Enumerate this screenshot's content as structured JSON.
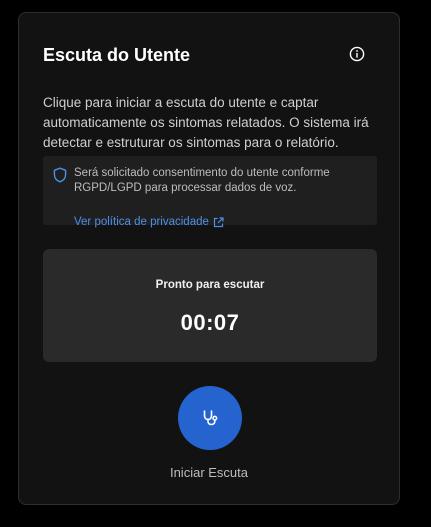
{
  "panel": {
    "title": "Escuta do Utente",
    "info_icon": "info-circle-icon",
    "description": "Clique para iniciar a escuta do utente e captar automaticamente os sintomas relatados. O sistema irá detectar e estruturar os sintomas para o relatório."
  },
  "consent": {
    "icon": "shield-icon",
    "text": "Será solicitado consentimento do utente conforme RGPD/LGPD para processar dados de voz.",
    "link_label": "Ver política de privacidade",
    "link_icon": "external-link-icon"
  },
  "timer": {
    "status": "Pronto para escutar",
    "value": "00:07"
  },
  "action": {
    "icon": "stethoscope-icon",
    "label": "Iniciar Escuta"
  },
  "colors": {
    "background": "#000000",
    "card": "#121212",
    "panel": "#2a2a2a",
    "notice": "#1f1f1f",
    "accent": "#2563cf",
    "link": "#4d8fe8"
  }
}
